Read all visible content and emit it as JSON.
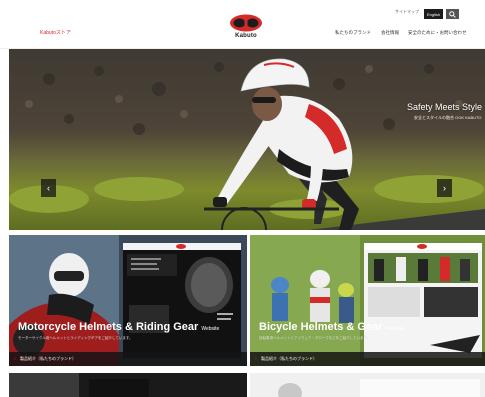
{
  "header": {
    "store_link": "Kabutoストア",
    "logo_text": "Kabuto",
    "top_links": [
      "サイトマップ"
    ],
    "language_label": "English",
    "nav": [
      "私たちのブランド",
      "会社情報",
      "安全のために・お問い合わせ"
    ]
  },
  "hero": {
    "title": "Safety Meets Style",
    "subtitle": "安全とスタイルの融合 OGK KABUTO",
    "prev": "‹",
    "next": "›"
  },
  "cards": [
    {
      "title": "Motorcycle Helmets & Riding Gear",
      "badge": "Website",
      "desc": "モーターサイクル用ヘルメットとライディングギアをご紹介しています。",
      "link": "製品紹介（私たちのブランド）"
    },
    {
      "title": "Bicycle Helmets & Gear",
      "badge": "Website",
      "desc": "自転車用ヘルメットとアイウェア・グローブなどをご紹介しています。",
      "link": "製品紹介（私たちのブランド）"
    }
  ],
  "colors": {
    "brand_red": "#d42a2a",
    "dark": "#1c1c1c"
  }
}
